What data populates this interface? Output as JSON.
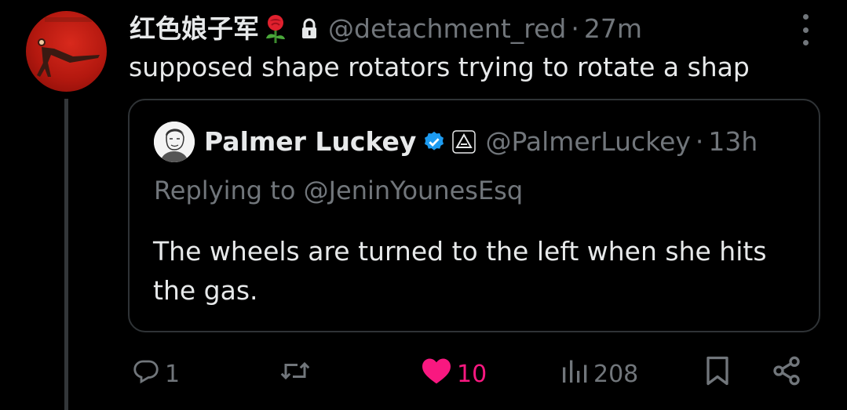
{
  "tweet": {
    "display_name": "红色娘子军",
    "name_emoji": "rose",
    "protected_icon": "lock-icon",
    "handle": "@detachment_red",
    "separator": "·",
    "time": "27m",
    "text": "supposed shape rotators trying to rotate a shap"
  },
  "quote": {
    "display_name": "Palmer Luckey",
    "verified_icon": "verified-badge-icon",
    "affiliation_icon": "anduril-affiliation-icon",
    "handle": "@PalmerLuckey",
    "separator": "·",
    "time": "13h",
    "replying_to": "Replying to @JeninYounesEsq",
    "text": "The wheels are turned to the left when she hits the gas."
  },
  "actions": {
    "reply_count": "1",
    "retweet_count": "",
    "like_count": "10",
    "view_count": "208"
  },
  "colors": {
    "background": "#000000",
    "text_primary": "#e7e9ea",
    "text_muted": "#71767b",
    "verified_blue": "#1d9bf0",
    "like_pink": "#f91880",
    "border": "#2f3336"
  }
}
